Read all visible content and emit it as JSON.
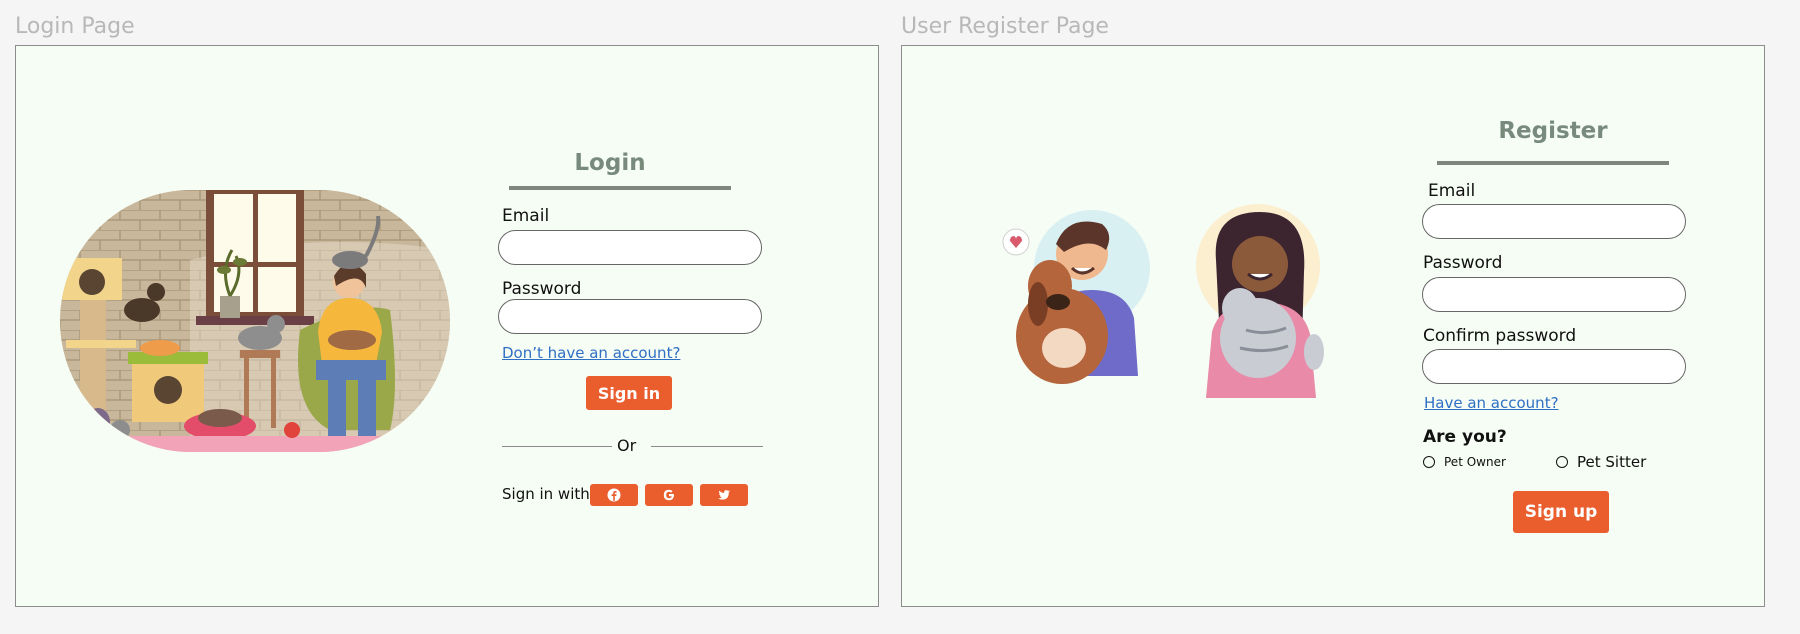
{
  "login_page": {
    "frame_title": "Login Page",
    "heading": "Login",
    "email_label": "Email",
    "email_value": "",
    "password_label": "Password",
    "password_value": "",
    "signup_link": "Don’t have an account?",
    "signin_button": "Sign in",
    "divider_text": "Or",
    "signin_with_label": "Sign in with",
    "social_icons": [
      "facebook-icon",
      "google-icon",
      "twitter-icon"
    ],
    "accent_color": "#ea5e2e"
  },
  "register_page": {
    "frame_title": "User Register Page",
    "heading": "Register",
    "email_label": "Email",
    "email_value": "",
    "password_label": "Password",
    "password_value": "",
    "confirm_password_label": "Confirm password",
    "confirm_password_value": "",
    "login_link": "Have an account?",
    "role_question": "Are you?",
    "role_options": [
      "Pet Owner",
      "Pet Sitter"
    ],
    "signup_button": "Sign up"
  }
}
